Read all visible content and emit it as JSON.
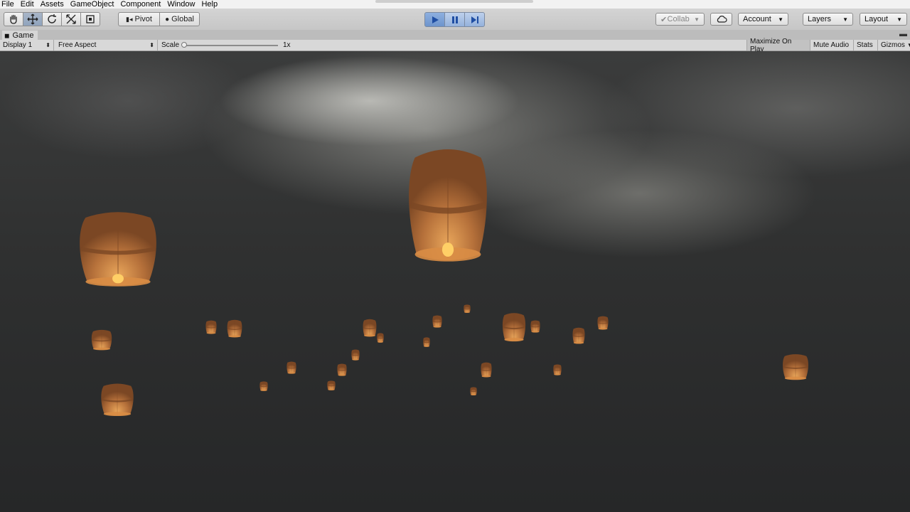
{
  "menu": [
    "File",
    "Edit",
    "Assets",
    "GameObject",
    "Component",
    "Window",
    "Help"
  ],
  "toolbar": {
    "tools": [
      "hand-icon",
      "move-icon",
      "rotate-icon",
      "scale-icon",
      "rect-icon"
    ],
    "pivot_label": "Pivot",
    "global_label": "Global",
    "play_icons": [
      "play-icon",
      "pause-icon",
      "step-icon"
    ],
    "collab_label": "Collab",
    "account_label": "Account",
    "layers_label": "Layers",
    "layout_label": "Layout"
  },
  "game": {
    "tab_label": "Game",
    "display_label": "Display 1",
    "aspect_label": "Free Aspect",
    "scale_label": "Scale",
    "scale_value": "1x",
    "maximize_label": "Maximize On Play",
    "mute_label": "Mute Audio",
    "stats_label": "Stats",
    "gizmos_label": "Gizmos"
  },
  "colors": {
    "lantern_body": "#b5703a",
    "lantern_shadow": "#7b4724",
    "flame": "#ffcf66",
    "play_active": "#6d94cc"
  }
}
